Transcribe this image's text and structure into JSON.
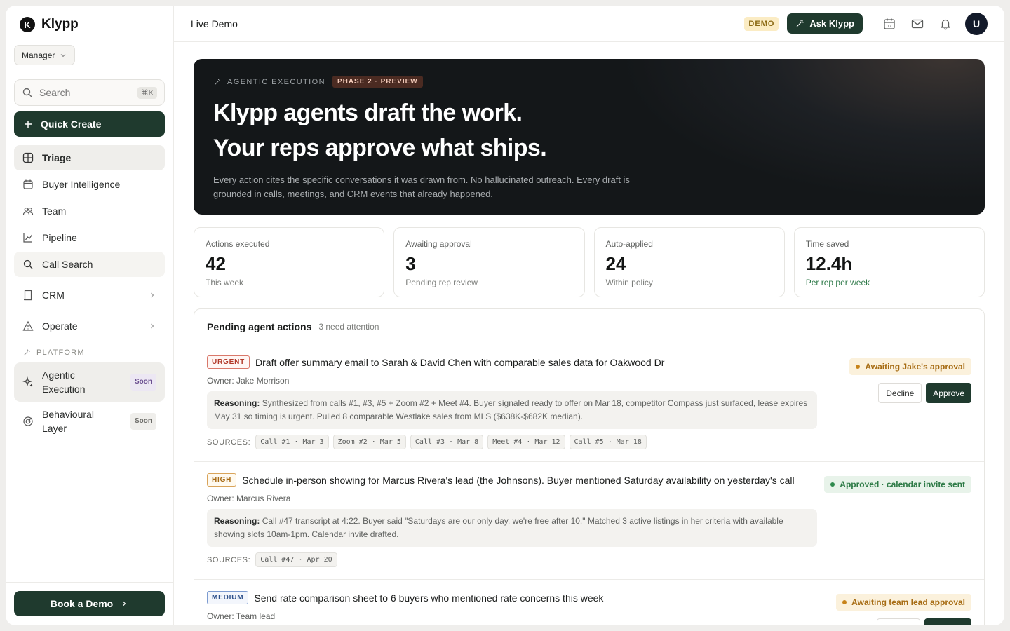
{
  "brand": {
    "name": "Klypp",
    "logo_letter": "K"
  },
  "role": {
    "selected": "Manager"
  },
  "search": {
    "placeholder": "Search",
    "shortcut": "⌘K"
  },
  "quick_create": {
    "label": "Quick Create"
  },
  "nav": {
    "items": [
      {
        "label": "Triage",
        "icon": "grid-icon"
      },
      {
        "label": "Buyer Intelligence",
        "icon": "calendar-icon"
      },
      {
        "label": "Team",
        "icon": "users-icon"
      },
      {
        "label": "Pipeline",
        "icon": "chart-icon"
      },
      {
        "label": "Call Search",
        "icon": "search-icon"
      },
      {
        "label": "CRM",
        "icon": "building-icon"
      },
      {
        "label": "Operate",
        "icon": "warning-icon"
      }
    ]
  },
  "platform": {
    "heading": "PLATFORM",
    "items": [
      {
        "label": "Agentic Execution",
        "badge": "Soon"
      },
      {
        "label": "Behavioural Layer",
        "badge": "Soon"
      }
    ]
  },
  "book_demo": {
    "label": "Book a Demo"
  },
  "topbar": {
    "title": "Live Demo",
    "badge": "DEMO",
    "ask_label": "Ask Klypp",
    "avatar_letter": "U"
  },
  "hero": {
    "tag": "AGENTIC EXECUTION",
    "phase": "PHASE 2 · PREVIEW",
    "line1": "Klypp agents draft the work.",
    "line2": "Your reps approve what ships.",
    "description": "Every action cites the specific conversations it was drawn from. No hallucinated outreach. Every draft is grounded in calls, meetings, and CRM events that already happened."
  },
  "stats": [
    {
      "label": "Actions executed",
      "value": "42",
      "sub": "This week"
    },
    {
      "label": "Awaiting approval",
      "value": "3",
      "sub": "Pending rep review"
    },
    {
      "label": "Auto-applied",
      "value": "24",
      "sub": "Within policy"
    },
    {
      "label": "Time saved",
      "value": "12.4h",
      "sub": "Per rep per week"
    }
  ],
  "panel": {
    "title": "Pending agent actions",
    "count": "3 need attention"
  },
  "actions": [
    {
      "priority": "URGENT",
      "title": "Draft offer summary email to Sarah & David Chen with comparable sales data for Oakwood Dr",
      "owner": "Owner: Jake Morrison",
      "reasoning_label": "Reasoning:",
      "reasoning": "Synthesized from calls #1, #3, #5 + Zoom #2 + Meet #4. Buyer signaled ready to offer on Mar 18, competitor Compass just surfaced, lease expires May 31 so timing is urgent. Pulled 8 comparable Westlake sales from MLS ($638K-$682K median).",
      "sources_label": "SOURCES:",
      "sources": [
        "Call #1 · Mar 3",
        "Zoom #2 · Mar 5",
        "Call #3 · Mar 8",
        "Meet #4 · Mar 12",
        "Call #5 · Mar 18"
      ],
      "status": "Awaiting Jake's approval",
      "decline": "Decline",
      "approve": "Approve"
    },
    {
      "priority": "HIGH",
      "title": "Schedule in-person showing for Marcus Rivera's lead (the Johnsons). Buyer mentioned Saturday availability on yesterday's call",
      "owner": "Owner: Marcus Rivera",
      "reasoning_label": "Reasoning:",
      "reasoning": "Call #47 transcript at 4:22. Buyer said \"Saturdays are our only day, we're free after 10.\" Matched 3 active listings in her criteria with available showing slots 10am-1pm. Calendar invite drafted.",
      "sources_label": "SOURCES:",
      "sources": [
        "Call #47 · Apr 20"
      ],
      "status": "Approved · calendar invite sent"
    },
    {
      "priority": "MEDIUM",
      "title": "Send rate comparison sheet to 6 buyers who mentioned rate concerns this week",
      "owner": "Owner: Team lead",
      "status": "Awaiting team lead approval"
    }
  ]
}
